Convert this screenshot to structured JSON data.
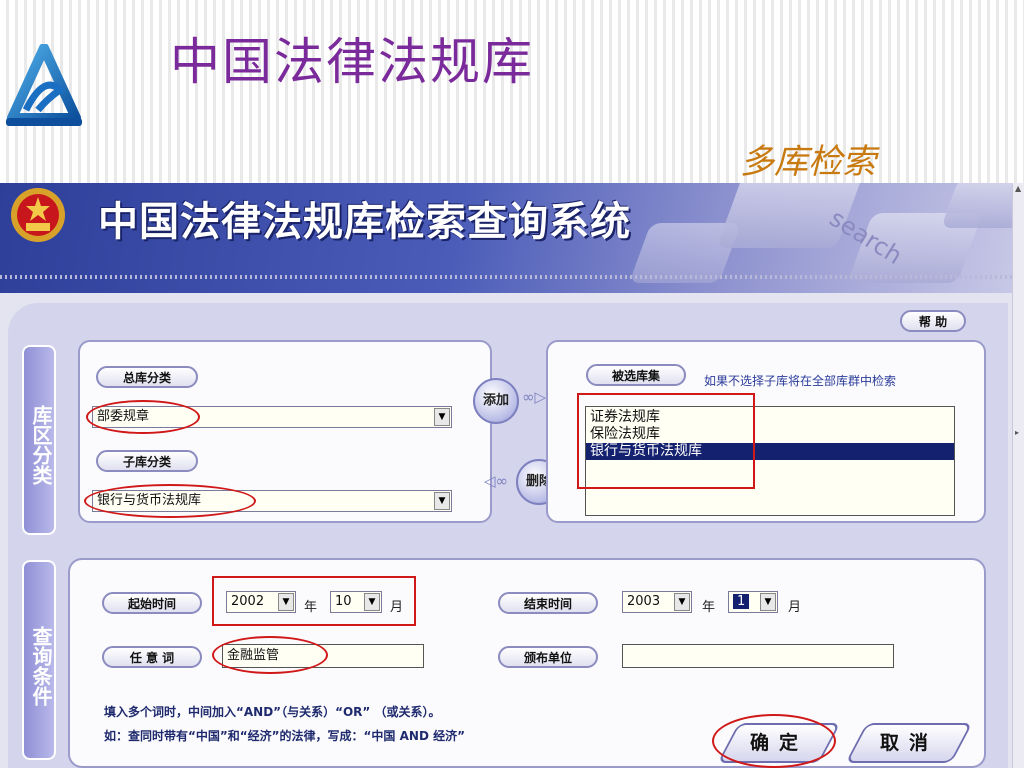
{
  "slide": {
    "title": "中国法律法规库",
    "subtitle": "多库检索"
  },
  "app": {
    "title": "中国法律法规库检索查询系统",
    "banner_word": "search",
    "help_button": "帮 助"
  },
  "library_section": {
    "tab_label": "库区分类",
    "main_category": {
      "label": "总库分类",
      "value": "部委规章"
    },
    "sub_category": {
      "label": "子库分类",
      "value": "银行与货币法规库"
    },
    "add_button": "添加",
    "delete_button": "删除",
    "selected_libraries": {
      "label": "被选库集",
      "hint": "如果不选择子库将在全部库群中检索",
      "items": [
        {
          "label": "证券法规库",
          "selected": false
        },
        {
          "label": "保险法规库",
          "selected": false
        },
        {
          "label": "银行与货币法规库",
          "selected": true
        }
      ]
    }
  },
  "query_section": {
    "tab_label": "查询条件",
    "start_time": {
      "label": "起始时间",
      "year": "2002",
      "year_unit": "年",
      "month": "10",
      "month_unit": "月"
    },
    "end_time": {
      "label": "结束时间",
      "year": "2003",
      "year_unit": "年",
      "month": "1",
      "month_unit": "月"
    },
    "keyword": {
      "label": "任 意 词",
      "value": "金融监管"
    },
    "issuer": {
      "label": "颁布单位",
      "value": ""
    },
    "notes": [
      "填入多个词时，中间加入“AND”（与关系）“OR” （或关系）。",
      "如：查同时带有“中国”和“经济”的法律，写成：“中国 AND 经济”"
    ],
    "confirm_button": "确定",
    "cancel_button": "取消"
  },
  "colors": {
    "slide_title": "#7a2a9a",
    "slide_subtitle": "#c87a10",
    "annotation_red": "#d01818",
    "list_selection": "#14216e"
  }
}
